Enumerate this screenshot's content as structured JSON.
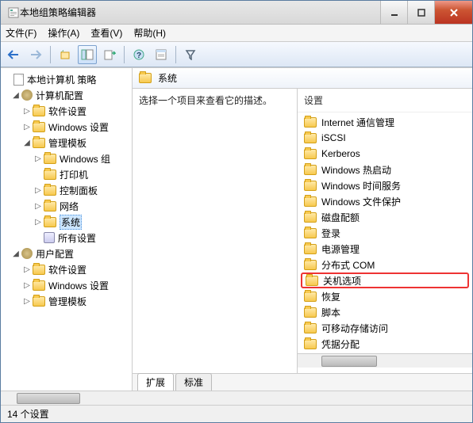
{
  "window": {
    "title": "本地组策略编辑器"
  },
  "menubar": [
    {
      "label": "文件(F)"
    },
    {
      "label": "操作(A)"
    },
    {
      "label": "查看(V)"
    },
    {
      "label": "帮助(H)"
    }
  ],
  "tree": {
    "root": "本地计算机 策略",
    "computer": "计算机配置",
    "softwareSettings": "软件设置",
    "windowsSettings": "Windows 设置",
    "adminTemplates": "管理模板",
    "windowsComponents": "Windows 组",
    "printers": "打印机",
    "controlPanel": "控制面板",
    "network": "网络",
    "system": "系统",
    "allSettings": "所有设置",
    "userConfig": "用户配置",
    "userSoftwareSettings": "软件设置",
    "userWindowsSettings": "Windows 设置",
    "userAdminTemplates": "管理模板"
  },
  "main": {
    "headerLabel": "系统",
    "descPrompt": "选择一个项目来查看它的描述。",
    "settingsHeader": "设置",
    "items": [
      {
        "label": "Internet 通信管理"
      },
      {
        "label": "iSCSI"
      },
      {
        "label": "Kerberos"
      },
      {
        "label": "Windows 热启动"
      },
      {
        "label": "Windows 时间服务"
      },
      {
        "label": "Windows 文件保护"
      },
      {
        "label": "磁盘配额"
      },
      {
        "label": "登录"
      },
      {
        "label": "电源管理"
      },
      {
        "label": "分布式 COM"
      },
      {
        "label": "关机选项"
      },
      {
        "label": "恢复"
      },
      {
        "label": "脚本"
      },
      {
        "label": "可移动存储访问"
      },
      {
        "label": "凭据分配"
      }
    ],
    "highlightedIndex": 10
  },
  "tabs": {
    "extended": "扩展",
    "standard": "标准"
  },
  "statusbar": {
    "text": "14 个设置"
  }
}
